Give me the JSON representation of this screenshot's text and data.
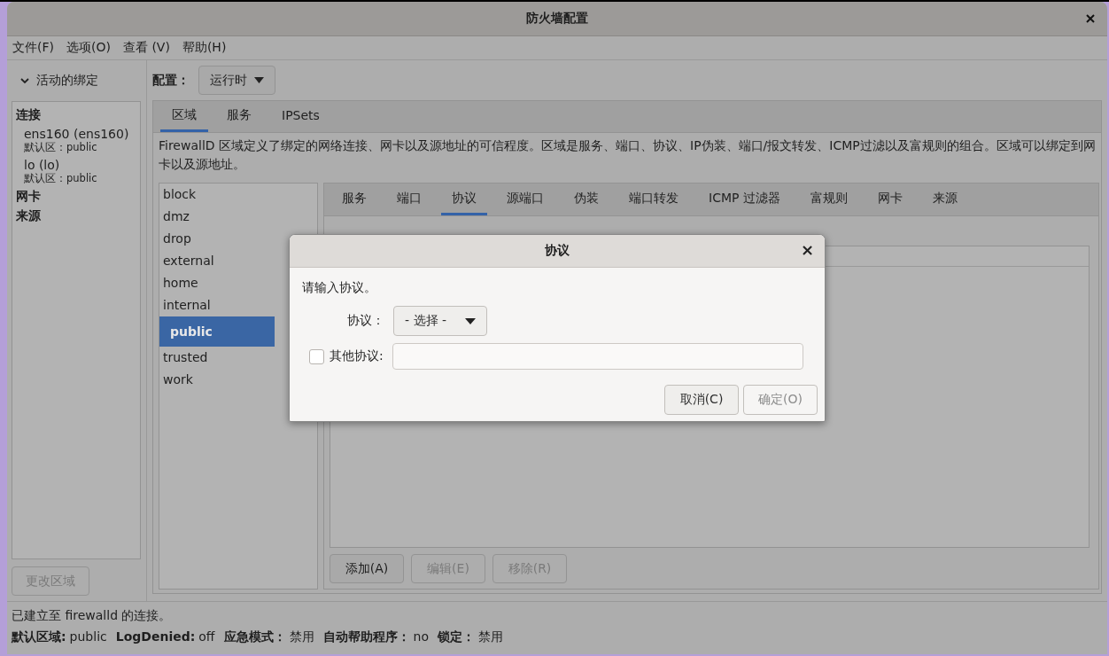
{
  "window": {
    "title": "防火墙配置"
  },
  "menu": [
    "文件(F)",
    "选项(O)",
    "查看 (V)",
    "帮助(H)"
  ],
  "sidebar": {
    "expander": {
      "label": "活动的绑定",
      "expanded": true
    },
    "sections": [
      {
        "label": "连接",
        "items": [
          {
            "name": "ens160 (ens160)",
            "zone": "默认区：public"
          },
          {
            "name": "lo (lo)",
            "zone": "默认区：public"
          }
        ]
      },
      {
        "label": "网卡"
      },
      {
        "label": "来源"
      }
    ],
    "button": {
      "label": "更改区域",
      "disabled": true
    }
  },
  "config": {
    "label": "配置：",
    "value": "运行时"
  },
  "tabs": [
    {
      "label": "区域",
      "selected": true
    },
    {
      "label": "服务",
      "selected": false
    },
    {
      "label": "IPSets",
      "selected": false
    }
  ],
  "description": "FirewallD 区域定义了绑定的网络连接、网卡以及源地址的可信程度。区域是服务、端口、协议、IP伪装、端口/报文转发、ICMP过滤以及富规则的组合。区域可以绑定到网卡以及源地址。",
  "zones": [
    {
      "label": "block",
      "selected": false
    },
    {
      "label": "dmz",
      "selected": false
    },
    {
      "label": "drop",
      "selected": false
    },
    {
      "label": "external",
      "selected": false
    },
    {
      "label": "home",
      "selected": false
    },
    {
      "label": "internal",
      "selected": false
    },
    {
      "label": "public",
      "selected": true
    },
    {
      "label": "trusted",
      "selected": false
    },
    {
      "label": "work",
      "selected": false
    }
  ],
  "zone_tabs": [
    {
      "label": "服务",
      "selected": false
    },
    {
      "label": "端口",
      "selected": false
    },
    {
      "label": "协议",
      "selected": true
    },
    {
      "label": "源端口",
      "selected": false
    },
    {
      "label": "伪装",
      "selected": false
    },
    {
      "label": "端口转发",
      "selected": false
    },
    {
      "label": "ICMP 过滤器",
      "selected": false
    },
    {
      "label": "富规则",
      "selected": false
    },
    {
      "label": "网卡",
      "selected": false
    },
    {
      "label": "来源",
      "selected": false
    }
  ],
  "actions": [
    {
      "label": "添加(A)",
      "disabled": false
    },
    {
      "label": "编辑(E)",
      "disabled": true
    },
    {
      "label": "移除(R)",
      "disabled": true
    }
  ],
  "status_bar": {
    "message": "已建立至 firewalld 的连接。",
    "fields": [
      {
        "label": "默认区域:",
        "value": "public"
      },
      {
        "label": "LogDenied:",
        "value": "off"
      },
      {
        "label": "应急模式：",
        "value": "禁用"
      },
      {
        "label": "自动帮助程序：",
        "value": "no"
      },
      {
        "label": "锁定：",
        "value": "禁用"
      }
    ]
  },
  "dialog": {
    "title": "协议",
    "close": "×",
    "prompt": "请输入协议。",
    "protocol_label": "协议：",
    "protocol_select": "- 选择 -",
    "other": {
      "label": "其他协议:",
      "checked": false
    },
    "buttons": [
      {
        "label": "取消(C)",
        "disabled": false
      },
      {
        "label": "确定(O)",
        "disabled": true
      }
    ]
  }
}
